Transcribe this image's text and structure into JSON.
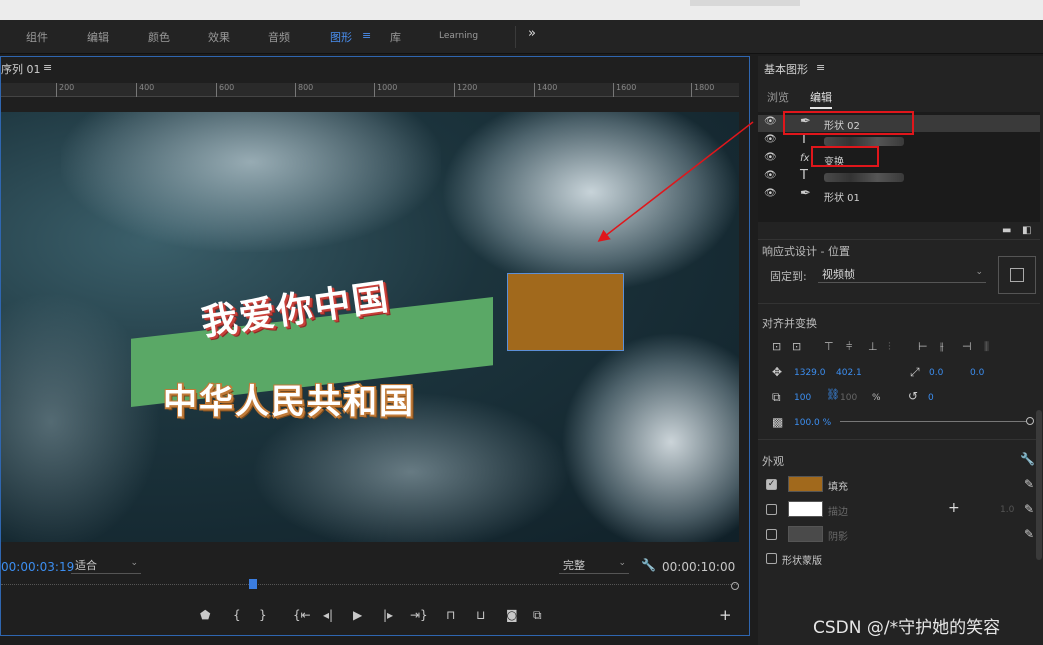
{
  "menubar": {
    "items": [
      "组件",
      "编辑",
      "颜色",
      "效果",
      "音频",
      "图形",
      "库",
      "Learning"
    ],
    "active_index": 5,
    "menu_icon": "≡",
    "overflow": "»"
  },
  "monitor": {
    "title": "序列 01",
    "menu_icon": "≡",
    "ruler_ticks": [
      "200",
      "400",
      "600",
      "800",
      "1000",
      "1200",
      "1400",
      "1600",
      "1800"
    ],
    "graphics": {
      "title1": "我爱你中国",
      "title2": "中华人民共和国",
      "rect_color": "#a1691c",
      "banner_color": "#5aa866"
    },
    "timecode_current": "00:00:03:19",
    "zoom_select": "适合",
    "quality_select": "完整",
    "timecode_duration": "00:00:10:00",
    "playhead_position": 0.34,
    "transport_icons": [
      "add-marker-icon",
      "mark-in-icon",
      "mark-out-icon",
      "go-to-in-icon",
      "step-back-icon",
      "play-icon",
      "step-forward-icon",
      "go-to-out-icon",
      "lift-icon",
      "extract-icon",
      "export-frame-icon",
      "compare-icon",
      "add-button-icon"
    ]
  },
  "essential_graphics": {
    "title": "基本图形",
    "menu_icon": "≡",
    "tabs": [
      "浏览",
      "编辑"
    ],
    "active_tab": 1,
    "layers": [
      {
        "kind": "pen-icon",
        "kind_glyph": "✒",
        "name": "形状 02",
        "selected": true
      },
      {
        "kind": "text-icon",
        "kind_glyph": "T",
        "name": "",
        "blurred": true
      },
      {
        "kind": "fx-icon",
        "kind_glyph": "fx",
        "name": "变换"
      },
      {
        "kind": "text-icon",
        "kind_glyph": "T",
        "name": "",
        "blurred": true
      },
      {
        "kind": "pen-icon",
        "kind_glyph": "✒",
        "name": "形状 01"
      }
    ],
    "responsive": {
      "title": "响应式设计 - 位置",
      "pin_label": "固定到:",
      "pin_value": "视频帧"
    },
    "align": {
      "title": "对齐并变换",
      "position_x": "1329.0",
      "position_y": "402.1",
      "anchor_x": "0.0",
      "anchor_y": "0.0",
      "scale_w": "100",
      "scale_h": "100",
      "scale_unit": "%",
      "rotation": "0",
      "opacity": "100.0 %"
    },
    "appearance": {
      "title": "外观",
      "fill_label": "填充",
      "fill_color": "#a1691c",
      "stroke_label": "描边",
      "stroke_color": "#ffffff",
      "stroke_width": "1.0",
      "shadow_label": "阴影",
      "shadow_color": "#4a4a4a",
      "mask_label": "形状蒙版"
    }
  },
  "watermark": "CSDN @/*守护她的笑容"
}
